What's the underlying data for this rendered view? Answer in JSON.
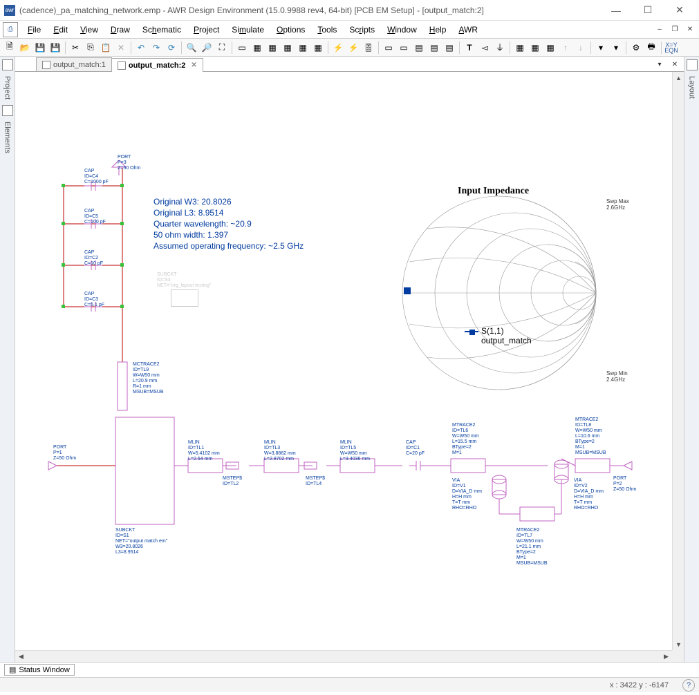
{
  "window": {
    "title": "(cadence)_pa_matching_network.emp - AWR Design Environment (15.0.9988 rev4, 64-bit) [PCB EM Setup] - [output_match:2]",
    "app_badge": "awr"
  },
  "menus": [
    "File",
    "Edit",
    "View",
    "Draw",
    "Schematic",
    "Project",
    "Simulate",
    "Options",
    "Tools",
    "Scripts",
    "Window",
    "Help",
    "AWR"
  ],
  "tabs": [
    {
      "label": "output_match:1",
      "active": false
    },
    {
      "label": "output_match:2",
      "active": true
    }
  ],
  "sidebar_left": [
    "Project",
    "Elements"
  ],
  "sidebar_right": [
    "Layout"
  ],
  "status": {
    "window_label": "Status Window",
    "coord": "x : 3422    y : -6147"
  },
  "annotations": [
    "Original W3: 20.8026",
    "Original L3: 8.9514",
    "Quarter wavelength: ~20.9",
    "50 ohm width: 1.397",
    "Assumed operating frequency: ~2.5 GHz"
  ],
  "params": {
    "port3": "PORT\nP=3\nZ=50 Ohm",
    "cap4": "CAP\nID=C4\nC=1000 pF",
    "cap5": "CAP\nID=C5\nC=100 pF",
    "cap2": "CAP\nID=C2\nC=10 pF",
    "cap3": "CAP\nID=C3\nC=5.1 pF",
    "subckt_grey": "SUBCKT\nID=S3\nNET=\"org_layout testing\"",
    "mtrace9": "MCTRACE2\nID=TL9\nW=W50 mm\nL=20.9 mm\nR=1 mm\nMSUB=MSUB",
    "port1": "PORT\nP=1\nZ=50 Ohm",
    "subckt_s1": "SUBCKT\nID=S1\nNET=\"output match em\"\nW3=20.8026\nL3=8.9514",
    "mlin1": "MLIN\nID=TL1\nW=5.4102 mm\nL=2.54 mm",
    "mstep2": "MSTEP$\nID=TL2",
    "mlin3": "MLIN\nID=TL3\nW=3.8862 mm\nL=2.8702 mm",
    "mstep4": "MSTEP$\nID=TL4",
    "mlin5": "MLIN\nID=TL5\nW=W50 mm\nL=3.4036 mm",
    "cap1": "CAP\nID=C1\nC=20 pF",
    "mtrace6": "MTRACE2\nID=TL6\nW=W50 mm\nL=15.5 mm\nBType=2\nM=1",
    "via1": "VIA\nID=V1\nD=VIA_D mm\nH=H mm\nT=T mm\nRHO=RHO",
    "mtrace7": "MTRACE2\nID=TL7\nW=W50 mm\nL=21.1 mm\nBType=2\nM=1\nMSUB=MSUB",
    "via2": "VIA\nID=V2\nD=VIA_D mm\nH=H mm\nT=T mm\nRHO=RHO",
    "mtrace8": "MTRACE2\nID=TL8\nW=W50 mm\nL=10.6 mm\nBType=2\nM=1\nMSUB=MSUB",
    "port2": "PORT\nP=2\nZ=50 Ohm"
  },
  "chart_data": {
    "type": "smith",
    "title": "Input Impedance",
    "swp_max": "Swp Max\n2.6GHz",
    "swp_min": "Swp Min\n2.4GHz",
    "series": [
      {
        "name": "S(1,1)",
        "source": "output_match",
        "points_desc": "Cluster near left edge (low real impedance) of Smith chart between 2.4 and 2.6 GHz"
      }
    ],
    "marker_approx_gamma": {
      "re": -0.95,
      "im": 0.0
    }
  }
}
